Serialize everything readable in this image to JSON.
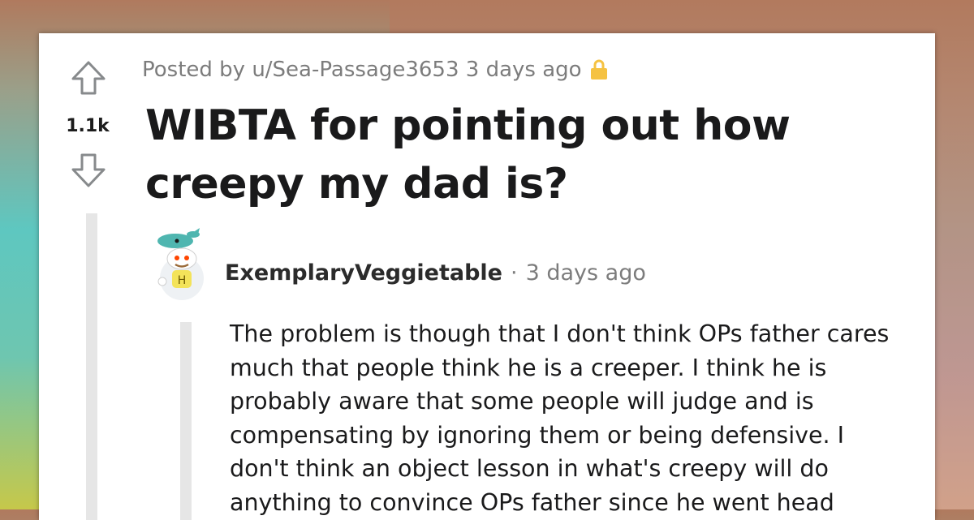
{
  "post": {
    "meta": {
      "posted_by": "Posted by u/Sea-Passage3653 3 days ago",
      "lock_icon": "lock-icon"
    },
    "vote": {
      "score": "1.1k",
      "upvote_icon": "upvote-arrow-icon",
      "downvote_icon": "downvote-arrow-icon"
    },
    "title": "WIBTA for pointing out how creepy my dad is?"
  },
  "comment": {
    "author": "ExemplaryVeggietable",
    "separator": "·",
    "time": "3 days ago",
    "avatar_icon": "snoo-avatar-icon",
    "body": "The problem is though that I don't think OPs father cares much that people think he is a creeper. I think he is probably aware that some people will judge and is compensating by ignoring them or being defensive. I don't think an object lesson in what's creepy will do anything to convince OPs father since he went head"
  },
  "colors": {
    "title": "#1a1a1b",
    "meta": "#7c7c7c",
    "lock": "#f5c242",
    "thread_line": "#e6e6e6",
    "avatar_teal": "#4fb6b0",
    "avatar_yellow": "#f3e35a"
  }
}
